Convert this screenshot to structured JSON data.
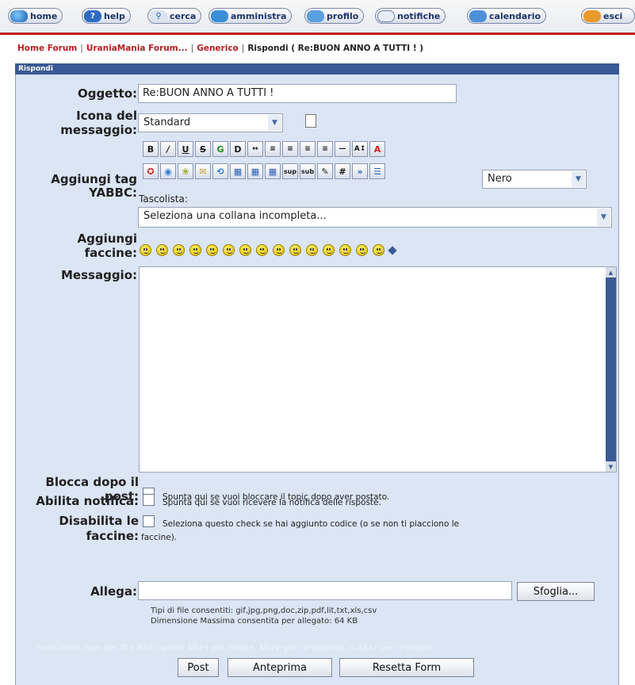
{
  "nav": {
    "items": [
      {
        "label": "home",
        "icon": "globe-icon"
      },
      {
        "label": "help",
        "icon": "help-icon"
      },
      {
        "label": "cerca",
        "icon": "search-icon"
      },
      {
        "label": "amministra",
        "icon": "admin-icon"
      },
      {
        "label": "profilo",
        "icon": "profile-icon"
      },
      {
        "label": "notifiche",
        "icon": "notifications-icon"
      },
      {
        "label": "calendario",
        "icon": "calendar-icon"
      },
      {
        "label": "esci",
        "icon": "logout-icon"
      }
    ]
  },
  "breadcrumb": {
    "home": "Home Forum",
    "forum": "UraniaMania Forum...",
    "category": "Generico",
    "current": "Rispondi ( Re:BUON ANNO A TUTTI ! )",
    "separator": "|"
  },
  "form": {
    "header": "Rispondi",
    "subject": {
      "label": "Oggetto:",
      "value": "Re:BUON ANNO A TUTTI !"
    },
    "icon": {
      "label_line1": "Icona del",
      "label_line2": "messaggio:",
      "selected": "Standard"
    },
    "tags": {
      "label_line1": "Aggiungi tag",
      "label_line2": "YABBC:",
      "color_selected": "Nero",
      "tascolista_label": "Tascolista:",
      "collana_selected": "Seleziona una collana incompleta..."
    },
    "smilies": {
      "label_line1": "Aggiungi",
      "label_line2": "faccine:",
      "count": 15
    },
    "message": {
      "label": "Messaggio:",
      "value": ""
    },
    "lock": {
      "label_line1": "Blocca dopo il",
      "label_line2": "post:",
      "text": "Spunta qui se vuoi bloccare il topic dopo aver postato."
    },
    "notify": {
      "label": "Abilita notifica:",
      "text": "Spunta qui se vuoi ricevere la notifica delle risposte."
    },
    "disable_smilies": {
      "label_line1": "Disabilita le",
      "label_line2": "faccine:",
      "text_line1": "Seleziona questo check se hai aggiunto codice (o se non ti piacciono le",
      "text_line2": "faccine)."
    },
    "attach": {
      "label": "Allega:",
      "browse": "Sfoglia...",
      "allowed": "Tipi di file consentiti: gif,jpg,png,doc,zip,pdf,lit,txt,xls,csv",
      "max_size": "Dimensione Massima consentita per allegato: 64 KB"
    },
    "shortcut_hint": "Scorciatoie (solo per IE e NS6): premi Alt+s per inviare, Alt+p per l'anteprima, o Alt+r per resettare",
    "buttons": {
      "post": "Post",
      "preview": "Anteprima",
      "reset": "Resetta Form"
    }
  },
  "colors": {
    "accent_red": "#c0211f",
    "header_blue": "#3a5a95",
    "form_bg": "#dbe5f4"
  }
}
